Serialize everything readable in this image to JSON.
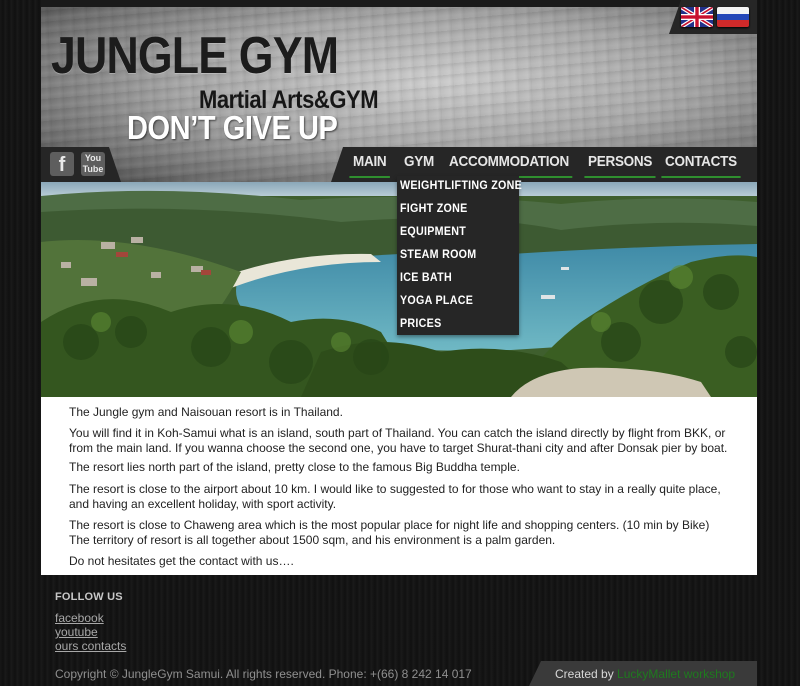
{
  "header": {
    "logo_title": "JUNGLE GYM",
    "logo_sub": "Martial Arts&GYM",
    "slogan": "DON’T GIVE UP"
  },
  "flags": [
    {
      "name": "english-flag-icon"
    },
    {
      "name": "russian-flag-icon"
    }
  ],
  "social": {
    "facebook_glyph": "f",
    "youtube_glyph_top": "You",
    "youtube_glyph_bottom": "Tube"
  },
  "nav": {
    "items": [
      "MAIN",
      "GYM",
      "ACCOMMODATION",
      "PERSONS",
      "CONTACTS"
    ],
    "active": "GYM",
    "accent_color": "#2f8f2f"
  },
  "dropdown": {
    "items": [
      "WEIGHTLIFTING ZONE",
      "FIGHT ZONE",
      "EQUIPMENT",
      "STEAM ROOM",
      "ICE BATH",
      "YOGA PLACE",
      "PRICES"
    ]
  },
  "content": {
    "paragraphs": [
      "The Jungle gym and Naisouan resort is in Thailand.",
      "You will find it in Koh-Samui what is an island, south part of Thailand. You can catch the island directly by flight from BKK, or from the main land. If you wanna choose the second one, you have to target Shurat-thani city and after Donsak pier by boat.",
      "The resort lies north part of the island, pretty close to the famous Big Buddha temple.",
      "The resort is close to the airport about 10 km. I would like to suggested to for those who want to stay in a really quite place, and having an excellent holiday, with sport activity.",
      "The resort is close to Chaweng area which is the most popular place for night life and shopping centers. (10 min by Bike) The territory of resort is all together about 1500 sqm, and his environment is a palm garden.",
      "Do not hesitates get the contact with us…."
    ]
  },
  "footer": {
    "follow_title": "FOLLOW US",
    "links": [
      "facebook",
      "youtube",
      "ours contacts"
    ],
    "copyright": "Copyright © JungleGym Samui. All rights reserved. Phone: +(66) 8 242 14 017",
    "created_by": "Created by",
    "creator": "LuckyMallet workshop",
    "creator_color": "#1e7a1e"
  }
}
